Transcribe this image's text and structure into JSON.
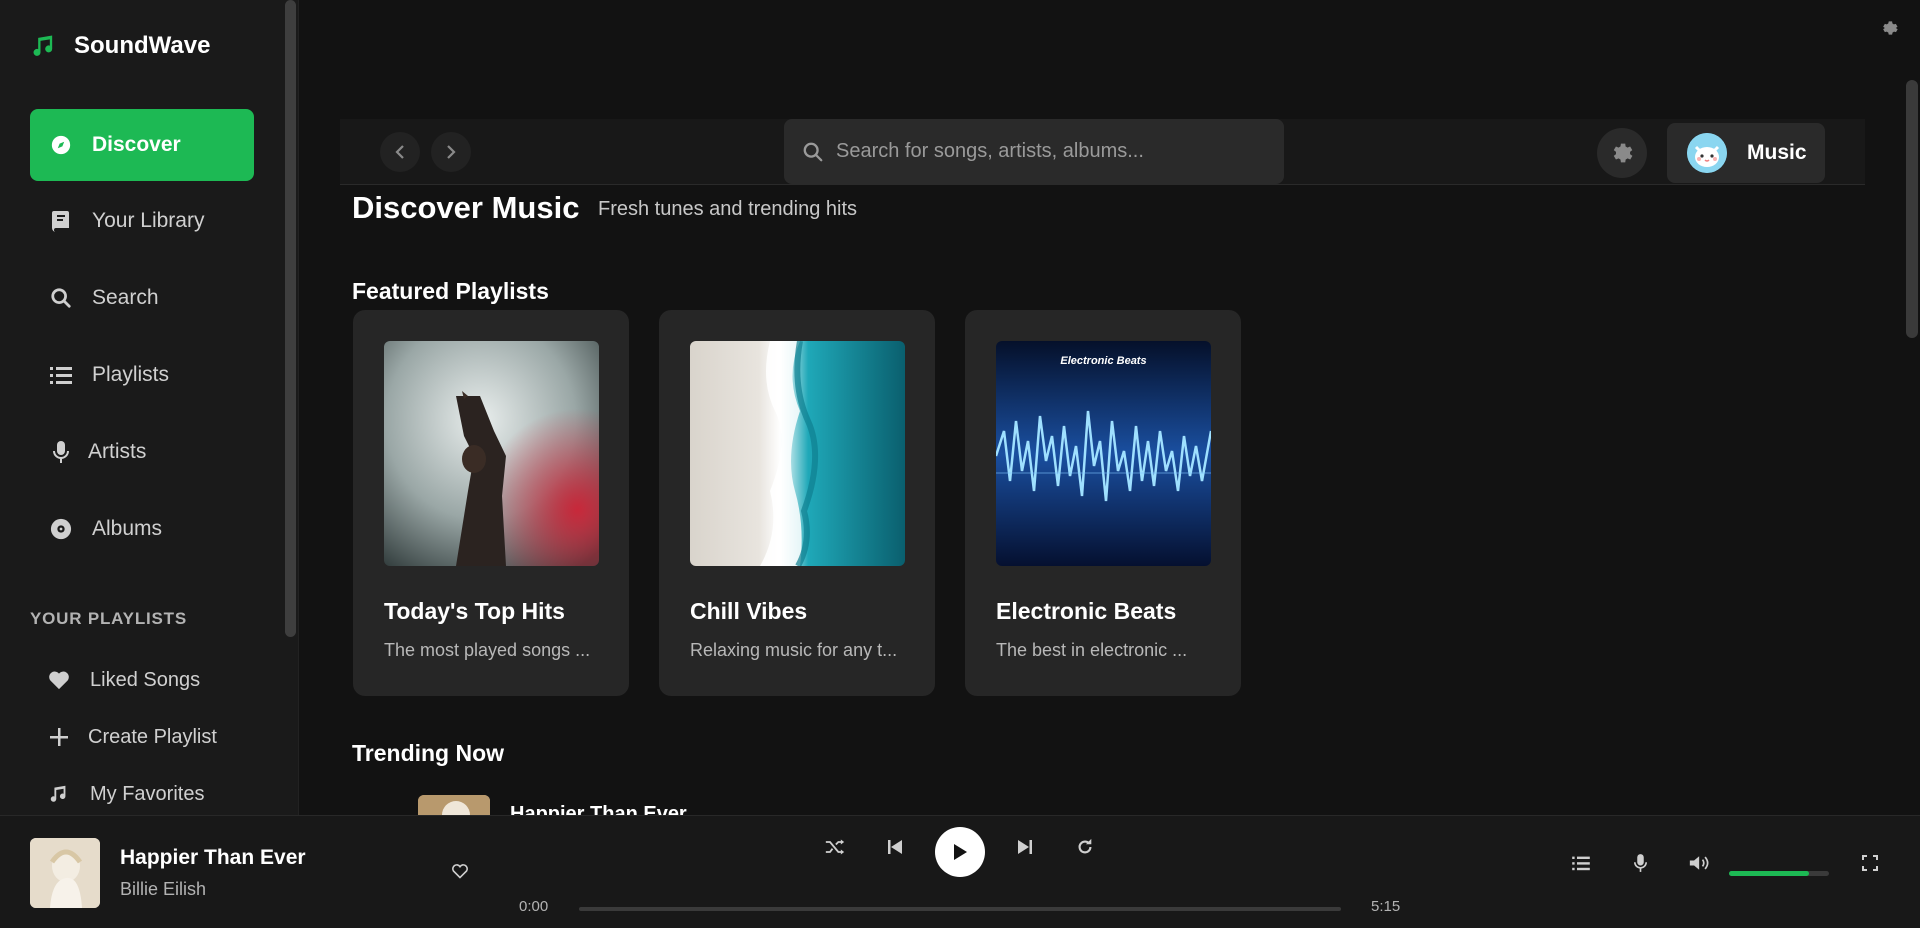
{
  "brand": {
    "name": "SoundWave"
  },
  "nav": [
    {
      "label": "Discover",
      "icon": "compass-icon",
      "active": true
    },
    {
      "label": "Your Library",
      "icon": "book-icon"
    },
    {
      "label": "Search",
      "icon": "search-icon"
    },
    {
      "label": "Playlists",
      "icon": "list-icon"
    },
    {
      "label": "Artists",
      "icon": "microphone-icon"
    },
    {
      "label": "Albums",
      "icon": "disc-icon"
    }
  ],
  "playlists_section": {
    "label": "YOUR PLAYLISTS",
    "items": [
      {
        "label": "Liked Songs",
        "icon": "heart-icon"
      },
      {
        "label": "Create Playlist",
        "icon": "plus-icon"
      },
      {
        "label": "My Favorites",
        "icon": "music-note-icon"
      }
    ]
  },
  "topbar": {
    "search_placeholder": "Search for songs, artists, albums...",
    "user_label": "Music"
  },
  "page": {
    "title": "Discover Music",
    "subtitle": "Fresh tunes and trending hits"
  },
  "featured": {
    "title": "Featured Playlists",
    "cards": [
      {
        "title": "Today's Top Hits",
        "description": "The most played songs ..."
      },
      {
        "title": "Chill Vibes",
        "description": "Relaxing music for any t..."
      },
      {
        "title": "Electronic Beats",
        "description": "The best in electronic ...",
        "art_text": "Electronic Beats"
      }
    ]
  },
  "trending": {
    "title": "Trending Now",
    "items": [
      {
        "title": "Happier Than Ever"
      }
    ]
  },
  "player": {
    "title": "Happier Than Ever",
    "artist": "Billie Eilish",
    "current_time": "0:00",
    "duration": "5:15",
    "progress": 0,
    "volume": 0.8
  },
  "colors": {
    "accent": "#1db954",
    "background": "#121212",
    "sidebar": "#1a1a1a",
    "card": "#262626"
  }
}
